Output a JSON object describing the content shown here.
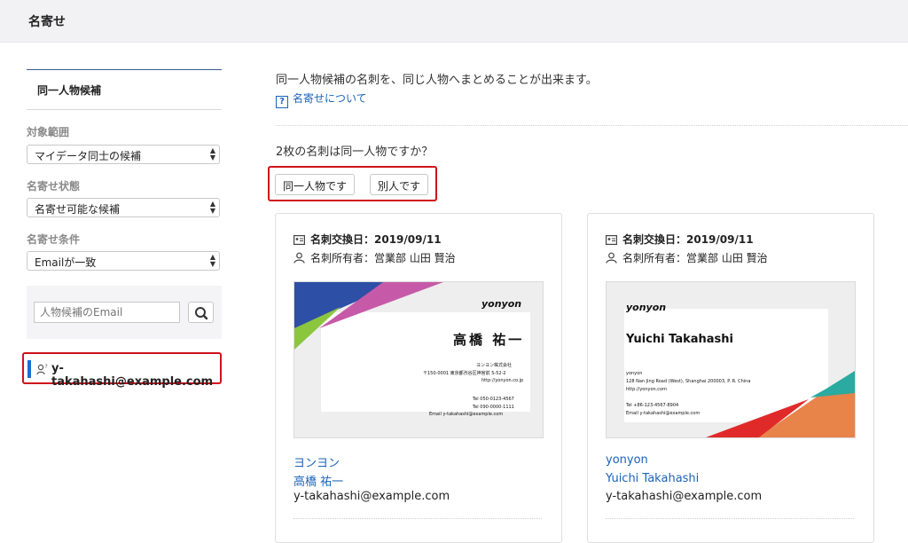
{
  "header": {
    "title": "名寄せ"
  },
  "sidebar": {
    "section_title": "同一人物候補",
    "scope_label": "対象範囲",
    "scope_value": "マイデータ同士の候補",
    "status_label": "名寄せ状態",
    "status_value": "名寄せ可能な候補",
    "condition_label": "名寄せ条件",
    "condition_value": "Emailが一致",
    "search_placeholder": "人物候補のEmail",
    "candidate_email": "y-takahashi@example.com"
  },
  "main": {
    "description": "同一人物候補の名刺を、同じ人物へまとめることが出来ます。",
    "help_link": "名寄せについて",
    "question": "2枚の名刺は同一人物ですか？",
    "same_button": "同一人物です",
    "different_button": "別人です"
  },
  "cards": [
    {
      "exchange_date": "名刺交換日：2019/09/11",
      "owner": "名刺所有者：営業部 山田 賢治",
      "company_link": "ヨンヨン",
      "name_link": "高橋 祐一",
      "email": "y-takahashi@example.com",
      "image": {
        "logo": "yonyon",
        "name": "高橋 祐一",
        "company": "ヨンヨン株式会社",
        "address": "〒150-0001 東京都渋谷区神宮前 5-52-2",
        "url": "http://yonyon.co.jp",
        "tel": "Tel 050-0123-4567",
        "tel2": "Tel 090-0000-1111",
        "email": "Email  y-takahashi@example.com"
      }
    },
    {
      "exchange_date": "名刺交換日：2019/09/11",
      "owner": "名刺所有者：営業部 山田 賢治",
      "company_link": "yonyon",
      "name_link": "Yuichi Takahashi",
      "email": "y-takahashi@example.com",
      "image": {
        "logo": "yonyon",
        "name": "Yuichi Takahashi",
        "company": "yonyon",
        "address": "128 Nan Jing Road (West), Shanghai 200003, P. R. China",
        "url": "http://yonyon.com",
        "tel": "Tel +86-123-4567-8904",
        "email": "Email  y-takahashi@example.com"
      }
    }
  ],
  "colors": {
    "accent_red": "#d0111b",
    "link_blue": "#1a63b8",
    "selected_bar": "#1a6fd1"
  },
  "icons": [
    "id-card-icon",
    "person-icon",
    "search-icon",
    "help-icon",
    "person-question-icon",
    "select-arrows-icon"
  ]
}
